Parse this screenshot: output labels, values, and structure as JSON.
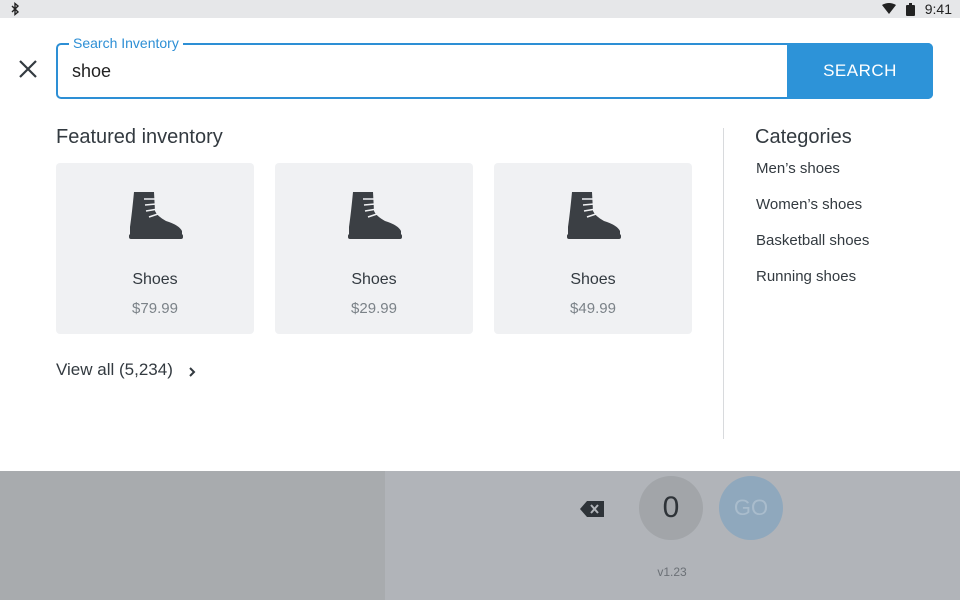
{
  "status_bar": {
    "time": "9:41",
    "icons": [
      "bluetooth-icon",
      "wifi-icon",
      "battery-icon"
    ]
  },
  "search": {
    "legend": "Search Inventory",
    "value": "shoe",
    "button_label": "SEARCH"
  },
  "featured": {
    "title": "Featured inventory",
    "items": [
      {
        "name": "Shoes",
        "price": "$79.99",
        "icon": "boot-icon"
      },
      {
        "name": "Shoes",
        "price": "$29.99",
        "icon": "boot-icon"
      },
      {
        "name": "Shoes",
        "price": "$49.99",
        "icon": "boot-icon"
      }
    ],
    "view_all": "View all (5,234)"
  },
  "categories": {
    "title": "Categories",
    "items": [
      "Men’s shoes",
      "Women’s shoes",
      "Basketball shoes",
      "Running shoes"
    ]
  },
  "keypad": {
    "zero": "0",
    "go": "GO",
    "version": "v1.23"
  },
  "colors": {
    "accent": "#2d93d8",
    "card_bg": "#f0f1f3",
    "overlay_left": "#a8abae",
    "overlay_right": "#b1b4b9"
  }
}
